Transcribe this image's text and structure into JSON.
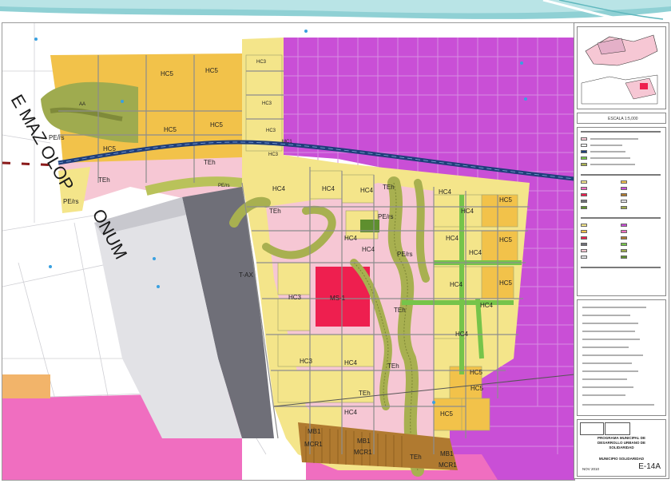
{
  "map": {
    "road_name_left": "E MAZ OLOP",
    "road_name_right": "ONUM",
    "zones": {
      "hc5_top_left": "HC5",
      "hc5_top_right": "HC5",
      "hc5_mid_a": "HC5",
      "hc5_mid_b": "HC5",
      "hc5_main": "HC5",
      "aa": "AA",
      "pers_a": "PE/rs",
      "pers_b": "PE/rs",
      "teh_a": "TEh",
      "teh_b": "TEh",
      "pers_c": "PE/rs",
      "hc3_a": "HC3",
      "hc3_b": "HC3",
      "hc3_c": "HC3",
      "hc3_d": "HC3",
      "mc1": "MC1",
      "hc4_a": "HC4",
      "hc4_b": "HC4",
      "hc4_c": "HC4",
      "teh_c": "TEh",
      "teh_d": "TEh",
      "tax": "T-AX",
      "ms1": "MS-1",
      "hc3_e": "HC3",
      "hc3_f": "HC3",
      "hc4_d": "HC4",
      "hc4_e": "HC4",
      "hc4_f": "HC4",
      "hc4_g": "HC4",
      "hc4_h": "HC4",
      "hc4_i": "HC4",
      "hc4_j": "HC4",
      "hc4_k": "HC4",
      "hc4_l": "HC4",
      "hc4_m": "HC4",
      "hc5_r1": "HC5",
      "hc5_r2": "HC5",
      "hc5_r3": "HC5",
      "hc5_r4": "HC5",
      "pers_d": "PE/rs",
      "pers_e": "PE/rs",
      "teh_e": "TEh",
      "teh_f": "TEh",
      "teh_g": "TEh",
      "hc4_n": "HC4",
      "hc5_r5": "HC5",
      "hc5_r6": "HC5",
      "mb1_a": "MB1",
      "mcr1_a": "MCR1",
      "mb1_b": "MB1",
      "mcr1_b": "MCR1",
      "mb1_c": "MB1",
      "mcr1_c": "MCR1",
      "teh_h": "TEh"
    }
  },
  "legend": {
    "scale": "ESCALA 1:5,000",
    "title_lines": [
      "PROGRAMA MUNICIPAL DE",
      "DESARROLLO URBANO DE",
      "SOLIDARIDAD"
    ],
    "subtitle": "MUNICIPIO SOLIDARIDAD",
    "date": "NOV 2010",
    "sheet": "E-14A"
  },
  "colors": {
    "banner_teal": "#7ec8cc",
    "purple": "#c94fd6",
    "pink_light": "#f6c7d4",
    "yellow_light": "#f4e58a",
    "orange_yellow": "#f2c24a",
    "olive_green": "#a8b050",
    "magenta_pink": "#f06ec0",
    "red": "#ee1f4f",
    "gray_dark": "#6f6f78",
    "gray_light": "#e2e2e6",
    "brown": "#b07a30",
    "green_bright": "#76c44a"
  }
}
